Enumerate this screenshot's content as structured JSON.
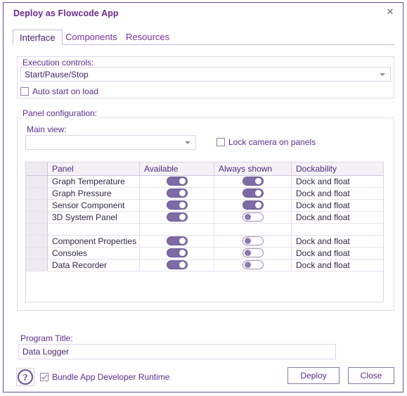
{
  "window": {
    "title": "Deploy as Flowcode App",
    "close_icon": "close-icon",
    "close_glyph": "✕"
  },
  "tabs": [
    {
      "label": "Interface",
      "active": true
    },
    {
      "label": "Components",
      "active": false
    },
    {
      "label": "Resources",
      "active": false
    }
  ],
  "execution": {
    "group_label": "Execution controls:",
    "combo_value": "Start/Pause/Stop",
    "auto_start": {
      "label": "Auto start on load",
      "checked": false
    }
  },
  "panel_config": {
    "group_label": "Panel configuration:",
    "main_view_label": "Main view:",
    "main_view_value": "",
    "lock_camera": {
      "label": "Lock camera on panels",
      "checked": false
    },
    "columns": [
      "Panel",
      "Available",
      "Always shown",
      "Dockability"
    ],
    "rows": [
      {
        "panel": "Graph Temperature",
        "available": "on",
        "always_shown": "on",
        "dockability": "Dock and float",
        "spacer": false
      },
      {
        "panel": "Graph Pressure",
        "available": "on",
        "always_shown": "on",
        "dockability": "Dock and float",
        "spacer": false
      },
      {
        "panel": "Sensor Component",
        "available": "on",
        "always_shown": "on",
        "dockability": "Dock and float",
        "spacer": false
      },
      {
        "panel": "3D System Panel",
        "available": "on",
        "always_shown": "off",
        "dockability": "Dock and float",
        "spacer": false
      },
      {
        "panel": "",
        "available": "",
        "always_shown": "",
        "dockability": "",
        "spacer": true
      },
      {
        "panel": "Component Properties",
        "available": "on",
        "always_shown": "off",
        "dockability": "Dock and float",
        "spacer": false
      },
      {
        "panel": "Consoles",
        "available": "on",
        "always_shown": "off",
        "dockability": "Dock and float",
        "spacer": false
      },
      {
        "panel": "Data Recorder",
        "available": "on",
        "always_shown": "off",
        "dockability": "Dock and float",
        "spacer": false
      }
    ]
  },
  "program_title": {
    "label": "Program Title:",
    "value": "Data Logger"
  },
  "footer": {
    "help_icon": "help-icon",
    "bundle": {
      "label": "Bundle App Developer Runtime",
      "checked": true
    },
    "deploy_label": "Deploy",
    "close_label": "Close"
  },
  "colors": {
    "accent": "#6d2a8c",
    "text": "#5b2d8e",
    "toggle_on": "#7e6aa5",
    "border": "#ded5e6",
    "header_bg": "#f4f1f7"
  }
}
